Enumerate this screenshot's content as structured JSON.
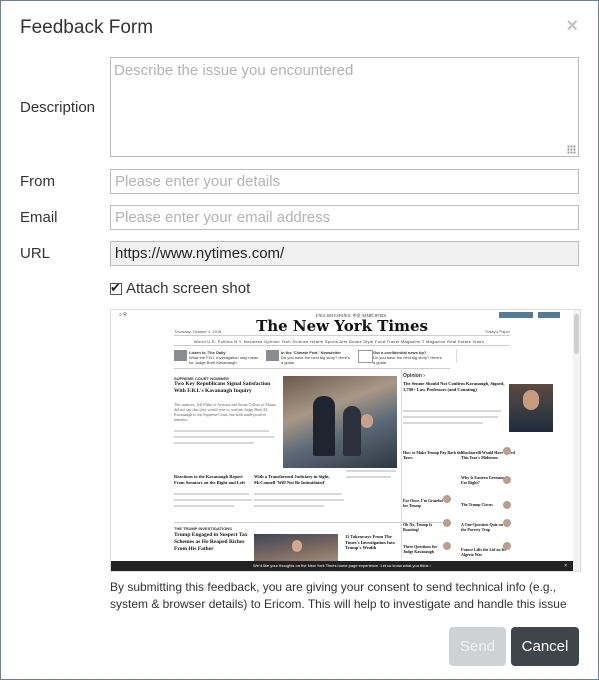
{
  "dialog": {
    "title": "Feedback Form",
    "close_symbol": "×"
  },
  "form": {
    "description": {
      "label": "Description",
      "placeholder": "Describe the issue you encountered",
      "value": ""
    },
    "from": {
      "label": "From",
      "placeholder": "Please enter your details",
      "value": ""
    },
    "email": {
      "label": "Email",
      "placeholder": "Please enter your email address",
      "value": ""
    },
    "url": {
      "label": "URL",
      "value": "https://www.nytimes.com/"
    },
    "attach": {
      "label": "Attach screen shot",
      "checked": true
    }
  },
  "screenshot": {
    "lang_links": "ENGLISH   ESPAÑOL   中文 (SIMPLIFIED)",
    "subscribe": "SUBSCRIBE NOW",
    "login": "LOG IN",
    "brand": "The New York Times",
    "date": "Thursday, October 4, 2018",
    "todays_paper": "Today's Paper",
    "nav": "World  U.S.  Politics  N.Y.  Business  Opinion  Tech  Science  Health  Sports  Arts  Books  Style  Food  Travel  Magazine  T Magazine  Real Estate  Video",
    "promos": [
      {
        "title": "Listen to 'The Daily'",
        "text": "What the F.B.I. investigation may mean for Judge Brett Kavanaugh."
      },
      {
        "title": "In the 'Climate Fwd:' Newsletter",
        "text": "Do you have the next big story? Here's a guide."
      },
      {
        "title": "Got a confidential news tip?",
        "text": "Do you have the next big story? Here's a guide."
      }
    ],
    "section_1": "SUPREME COURT NOMINEE",
    "headline_1": "Two Key Republicans Signal Satisfaction With F.B.I.'s Kavanaugh Inquiry",
    "text_1": "The senators, Jeff Flake of Arizona and Susan Collins of Maine, did not say that they would vote to confirm Judge Brett M. Kavanaugh to the Supreme Court, but both made positive remarks.",
    "headline_2": "Reactions to the Kavanaugh Report From Senators on the Right and Left",
    "headline_3": "With a Transformed Judiciary in Sight, McConnell 'Will Not Be Intimidated'",
    "section_2": "THE TRUMP INVESTIGATIONS",
    "headline_4": "Trump Engaged in Suspect Tax Schemes as He Reaped Riches From His Father",
    "headline_5": "11 Takeaways From The Times's Investigation Into Trump's Wealth",
    "opinion_head": "Opinion ›",
    "opinion_1": "The Senate Should Not Confirm Kavanaugh, Signed, 1,700+ Law Professors (and Counting)",
    "opinion_2": "How to Make Trump Pay Back the Taxes",
    "opinion_3": "Machiavelli Would Have Loved This Year's Midterms",
    "opinion_4": "Why Is Eastern Germany So Far Right?",
    "opinion_5": "For Once, I'm Grateful for Trump",
    "opinion_6": "The Trump Circus",
    "opinion_7": "Oh No, Trump Is Boasting!",
    "opinion_8": "A One-Question Quiz on the Poverty Trap",
    "opinion_9": "Three Questions for Judge Kavanaugh",
    "opinion_10": "France Lifts the Lid on Its Algeria War",
    "bottom_bar": "We'd like your thoughts on the New York Times home page experience. Let us know what you think ›",
    "bottom_close": "×"
  },
  "consent_text": "By submitting this feedback, you are giving your consent to send technical info (e.g., system & browser details) to Ericom. This will help to investigate and handle this issue",
  "buttons": {
    "send": "Send",
    "cancel": "Cancel"
  },
  "colors": {
    "cancel_bg": "#3f4549",
    "send_bg_disabled": "#cfd1d3",
    "border": "#6f7f8c"
  }
}
